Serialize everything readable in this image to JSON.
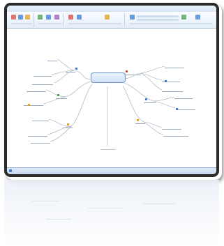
{
  "tabs": [
    "",
    "",
    "",
    "",
    "",
    "",
    ""
  ],
  "central_topic": {
    "line1": "",
    "line2": ""
  },
  "ribbon_buttons": [
    {
      "color": "#d24a3a"
    },
    {
      "color": "#3a7bd5"
    },
    {
      "color": "#e0a020"
    },
    {
      "color": "#4aa04a"
    },
    {
      "color": "#3a7bd5"
    },
    {
      "color": "#9a5ab5"
    },
    {
      "color": "#d24a3a"
    },
    {
      "color": "#3a7bd5"
    },
    {
      "color": "#e0a020"
    },
    {
      "color": "#3a7bd5"
    },
    {
      "color": "#4aa04a"
    },
    {
      "color": "#3a7bd5"
    },
    {
      "color": "#d24a3a"
    },
    {
      "color": "#3a7bd5"
    }
  ],
  "status": {
    "left": ""
  },
  "colors": {
    "accent": "#6b93c8",
    "branch": "#9aa9b8",
    "node_icon_blue": "#3a7bd5",
    "node_icon_orange": "#e0a020"
  }
}
